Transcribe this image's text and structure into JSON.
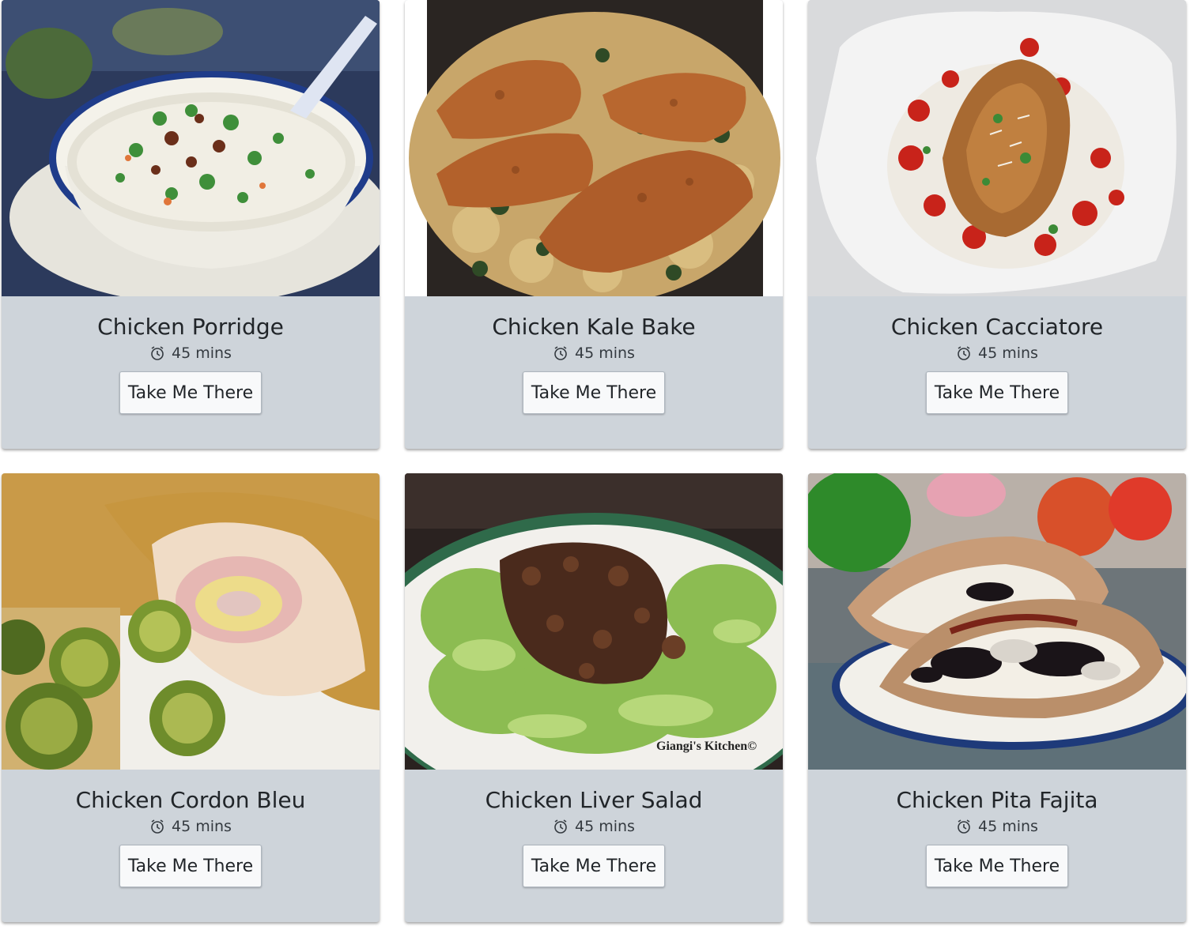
{
  "recipes": [
    {
      "title": "Chicken Porridge",
      "time": "45 mins",
      "button_label": "Take Me There",
      "photo": "chicken-porridge"
    },
    {
      "title": "Chicken Kale Bake",
      "time": "45 mins",
      "button_label": "Take Me There",
      "photo": "chicken-kale-bake"
    },
    {
      "title": "Chicken Cacciatore",
      "time": "45 mins",
      "button_label": "Take Me There",
      "photo": "chicken-cacciatore"
    },
    {
      "title": "Chicken Cordon Bleu",
      "time": "45 mins",
      "button_label": "Take Me There",
      "photo": "chicken-cordon-bleu"
    },
    {
      "title": "Chicken Liver Salad",
      "time": "45 mins",
      "button_label": "Take Me There",
      "photo": "chicken-liver-salad",
      "watermark": "Giangi's Kitchen©"
    },
    {
      "title": "Chicken Pita Fajita",
      "time": "45 mins",
      "button_label": "Take Me There",
      "photo": "chicken-pita-fajita"
    }
  ],
  "icons": {
    "time": "alarm-clock-icon"
  },
  "colors": {
    "card_bg": "#ced4da",
    "button_bg": "#f8f9fa",
    "text": "#212529"
  }
}
